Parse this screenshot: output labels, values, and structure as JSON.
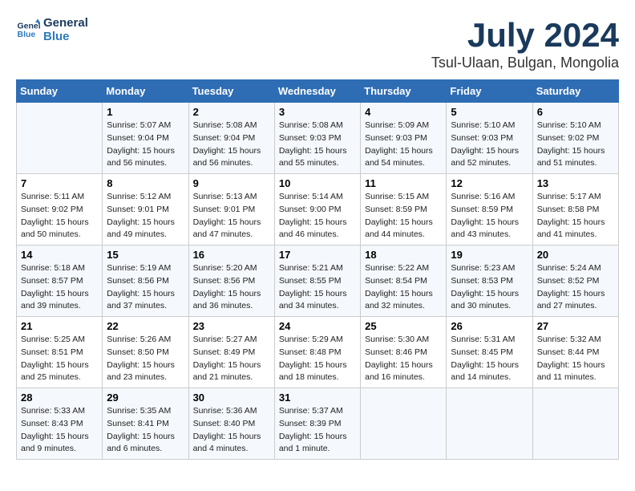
{
  "header": {
    "logo_line1": "General",
    "logo_line2": "Blue",
    "month": "July 2024",
    "location": "Tsul-Ulaan, Bulgan, Mongolia"
  },
  "weekdays": [
    "Sunday",
    "Monday",
    "Tuesday",
    "Wednesday",
    "Thursday",
    "Friday",
    "Saturday"
  ],
  "weeks": [
    [
      {
        "day": "",
        "info": ""
      },
      {
        "day": "1",
        "info": "Sunrise: 5:07 AM\nSunset: 9:04 PM\nDaylight: 15 hours\nand 56 minutes."
      },
      {
        "day": "2",
        "info": "Sunrise: 5:08 AM\nSunset: 9:04 PM\nDaylight: 15 hours\nand 56 minutes."
      },
      {
        "day": "3",
        "info": "Sunrise: 5:08 AM\nSunset: 9:03 PM\nDaylight: 15 hours\nand 55 minutes."
      },
      {
        "day": "4",
        "info": "Sunrise: 5:09 AM\nSunset: 9:03 PM\nDaylight: 15 hours\nand 54 minutes."
      },
      {
        "day": "5",
        "info": "Sunrise: 5:10 AM\nSunset: 9:03 PM\nDaylight: 15 hours\nand 52 minutes."
      },
      {
        "day": "6",
        "info": "Sunrise: 5:10 AM\nSunset: 9:02 PM\nDaylight: 15 hours\nand 51 minutes."
      }
    ],
    [
      {
        "day": "7",
        "info": "Sunrise: 5:11 AM\nSunset: 9:02 PM\nDaylight: 15 hours\nand 50 minutes."
      },
      {
        "day": "8",
        "info": "Sunrise: 5:12 AM\nSunset: 9:01 PM\nDaylight: 15 hours\nand 49 minutes."
      },
      {
        "day": "9",
        "info": "Sunrise: 5:13 AM\nSunset: 9:01 PM\nDaylight: 15 hours\nand 47 minutes."
      },
      {
        "day": "10",
        "info": "Sunrise: 5:14 AM\nSunset: 9:00 PM\nDaylight: 15 hours\nand 46 minutes."
      },
      {
        "day": "11",
        "info": "Sunrise: 5:15 AM\nSunset: 8:59 PM\nDaylight: 15 hours\nand 44 minutes."
      },
      {
        "day": "12",
        "info": "Sunrise: 5:16 AM\nSunset: 8:59 PM\nDaylight: 15 hours\nand 43 minutes."
      },
      {
        "day": "13",
        "info": "Sunrise: 5:17 AM\nSunset: 8:58 PM\nDaylight: 15 hours\nand 41 minutes."
      }
    ],
    [
      {
        "day": "14",
        "info": "Sunrise: 5:18 AM\nSunset: 8:57 PM\nDaylight: 15 hours\nand 39 minutes."
      },
      {
        "day": "15",
        "info": "Sunrise: 5:19 AM\nSunset: 8:56 PM\nDaylight: 15 hours\nand 37 minutes."
      },
      {
        "day": "16",
        "info": "Sunrise: 5:20 AM\nSunset: 8:56 PM\nDaylight: 15 hours\nand 36 minutes."
      },
      {
        "day": "17",
        "info": "Sunrise: 5:21 AM\nSunset: 8:55 PM\nDaylight: 15 hours\nand 34 minutes."
      },
      {
        "day": "18",
        "info": "Sunrise: 5:22 AM\nSunset: 8:54 PM\nDaylight: 15 hours\nand 32 minutes."
      },
      {
        "day": "19",
        "info": "Sunrise: 5:23 AM\nSunset: 8:53 PM\nDaylight: 15 hours\nand 30 minutes."
      },
      {
        "day": "20",
        "info": "Sunrise: 5:24 AM\nSunset: 8:52 PM\nDaylight: 15 hours\nand 27 minutes."
      }
    ],
    [
      {
        "day": "21",
        "info": "Sunrise: 5:25 AM\nSunset: 8:51 PM\nDaylight: 15 hours\nand 25 minutes."
      },
      {
        "day": "22",
        "info": "Sunrise: 5:26 AM\nSunset: 8:50 PM\nDaylight: 15 hours\nand 23 minutes."
      },
      {
        "day": "23",
        "info": "Sunrise: 5:27 AM\nSunset: 8:49 PM\nDaylight: 15 hours\nand 21 minutes."
      },
      {
        "day": "24",
        "info": "Sunrise: 5:29 AM\nSunset: 8:48 PM\nDaylight: 15 hours\nand 18 minutes."
      },
      {
        "day": "25",
        "info": "Sunrise: 5:30 AM\nSunset: 8:46 PM\nDaylight: 15 hours\nand 16 minutes."
      },
      {
        "day": "26",
        "info": "Sunrise: 5:31 AM\nSunset: 8:45 PM\nDaylight: 15 hours\nand 14 minutes."
      },
      {
        "day": "27",
        "info": "Sunrise: 5:32 AM\nSunset: 8:44 PM\nDaylight: 15 hours\nand 11 minutes."
      }
    ],
    [
      {
        "day": "28",
        "info": "Sunrise: 5:33 AM\nSunset: 8:43 PM\nDaylight: 15 hours\nand 9 minutes."
      },
      {
        "day": "29",
        "info": "Sunrise: 5:35 AM\nSunset: 8:41 PM\nDaylight: 15 hours\nand 6 minutes."
      },
      {
        "day": "30",
        "info": "Sunrise: 5:36 AM\nSunset: 8:40 PM\nDaylight: 15 hours\nand 4 minutes."
      },
      {
        "day": "31",
        "info": "Sunrise: 5:37 AM\nSunset: 8:39 PM\nDaylight: 15 hours\nand 1 minute."
      },
      {
        "day": "",
        "info": ""
      },
      {
        "day": "",
        "info": ""
      },
      {
        "day": "",
        "info": ""
      }
    ]
  ]
}
